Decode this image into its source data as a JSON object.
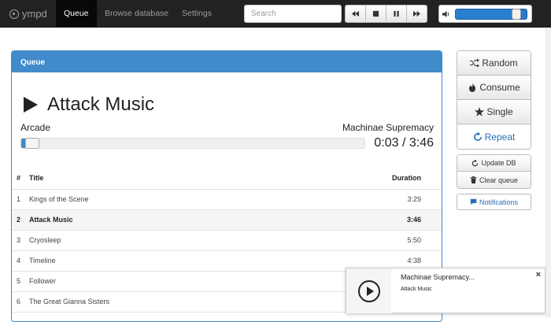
{
  "app": {
    "brand": "ympd"
  },
  "nav": {
    "items": [
      {
        "label": "Queue",
        "active": true
      },
      {
        "label": "Browse database",
        "active": false
      },
      {
        "label": "Settings",
        "active": false
      }
    ]
  },
  "search": {
    "placeholder": "Search",
    "value": ""
  },
  "controls": {
    "prev_icon": "fast-backward-icon",
    "stop_icon": "stop-icon",
    "pause_icon": "pause-icon",
    "next_icon": "fast-forward-icon"
  },
  "volume": {
    "icon": "volume-up-icon",
    "level": 0.85
  },
  "queue_panel": {
    "heading": "Queue",
    "now_playing": {
      "title": "Attack Music",
      "album": "Arcade",
      "artist": "Machinae Supremacy",
      "counter": "0:03 / 3:46",
      "progress": 0.0133
    },
    "columns": {
      "num": "#",
      "title": "Title",
      "duration": "Duration"
    },
    "rows": [
      {
        "num": "1",
        "title": "Kings of the Scene",
        "duration": "3:29",
        "current": false
      },
      {
        "num": "2",
        "title": "Attack Music",
        "duration": "3:46",
        "current": true
      },
      {
        "num": "3",
        "title": "Cryosleep",
        "duration": "5:50",
        "current": false
      },
      {
        "num": "4",
        "title": "Timeline",
        "duration": "4:38",
        "current": false
      },
      {
        "num": "5",
        "title": "Follower",
        "duration": "",
        "current": false
      },
      {
        "num": "6",
        "title": "The Great Gianna Sisters",
        "duration": "",
        "current": false
      }
    ]
  },
  "side": {
    "modes": [
      {
        "label": "Random",
        "icon": "random-icon",
        "active": false
      },
      {
        "label": "Consume",
        "icon": "fire-icon",
        "active": false
      },
      {
        "label": "Single",
        "icon": "star-icon",
        "active": false
      },
      {
        "label": "Repeat",
        "icon": "repeat-icon",
        "active": true
      }
    ],
    "update_db": "Update DB",
    "clear_queue": "Clear queue",
    "notifications": "Notifications"
  },
  "toast": {
    "title": "Machinae Supremacy...",
    "body": "Attack Music",
    "close": "×"
  },
  "colors": {
    "accent": "#428bca",
    "navbar": "#222222",
    "active_link": "#2a6fb8"
  }
}
